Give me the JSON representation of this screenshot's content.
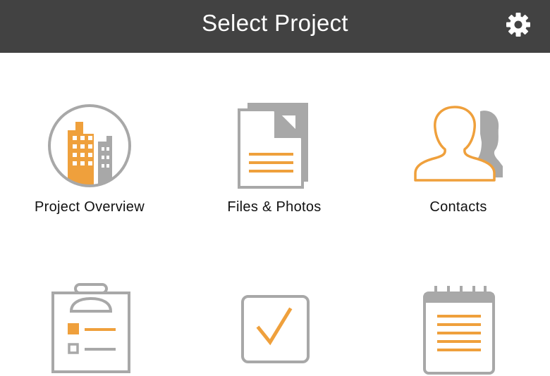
{
  "header": {
    "title": "Select Project",
    "settings_icon": "gear-icon"
  },
  "colors": {
    "header_bg": "#424242",
    "accent_orange": "#EFA03C",
    "icon_gray": "#A8A8A8"
  },
  "tiles": [
    {
      "label": "Project Overview",
      "icon": "buildings-icon"
    },
    {
      "label": "Files & Photos",
      "icon": "document-icon"
    },
    {
      "label": "Contacts",
      "icon": "people-icon"
    },
    {
      "label": "",
      "icon": "clipboard-list-icon"
    },
    {
      "label": "",
      "icon": "checkbox-icon"
    },
    {
      "label": "",
      "icon": "notepad-icon"
    }
  ]
}
